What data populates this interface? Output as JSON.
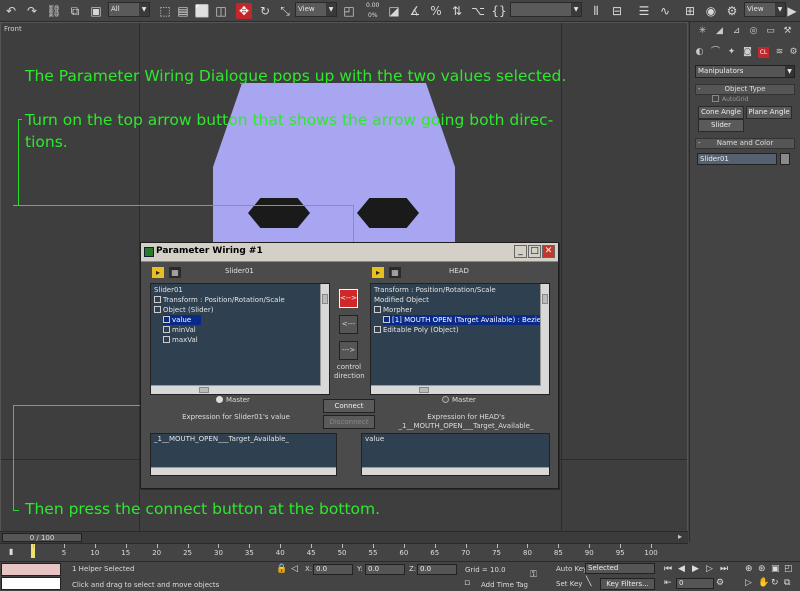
{
  "toolbar": {
    "selection_filter": "All",
    "ref_coord": "View",
    "snap_value": "0.00",
    "snap_unit": "0%",
    "named_selection": "",
    "view_dropdown": "View"
  },
  "viewport": {
    "label": "Front",
    "annotations": {
      "line1": "The Parameter Wiring Dialogue pops up with the two values selected.",
      "line2": "Turn on the top arrow button that shows the arrow going both direc-",
      "line3": "tions.",
      "line4": "Then press the connect button at the bottom."
    }
  },
  "dialog": {
    "title": "Parameter Wiring #1",
    "left_header": "Slider01",
    "right_header": "HEAD",
    "left_tree": [
      "Slider01",
      "Transform : Position/Rotation/Scale",
      "Object (Slider)",
      "value",
      "minVal",
      "maxVal"
    ],
    "right_tree": [
      "Transform : Position/Rotation/Scale",
      "Modified Object",
      "Morpher",
      "[1] MOUTH OPEN  (Target Available) : Bezier Float",
      "Editable Poly (Object)"
    ],
    "btn_both": "<-->",
    "btn_left": "<---",
    "btn_right": "--->",
    "control_direction": [
      "control",
      "direction"
    ],
    "master_left": "Master",
    "master_right": "Master",
    "connect": "Connect",
    "disconnect": "Disconnect",
    "expr_left_label": "Expression for Slider01's value",
    "expr_right_label": [
      "Expression for HEAD's",
      "_1__MOUTH_OPEN___Target_Available_"
    ],
    "expr_left_value": "_1__MOUTH_OPEN___Target_Available_",
    "expr_right_value": "value"
  },
  "command_panel": {
    "category": "Manipulators",
    "rollout_object_type": "Object Type",
    "autogrid": "AutoGrid",
    "buttons": [
      "Cone Angle",
      "Plane Angle",
      "Slider"
    ],
    "rollout_name_color": "Name and Color",
    "object_name": "Slider01"
  },
  "timeline": {
    "frame_indicator": "0 / 100",
    "ticks": [
      "5",
      "10",
      "15",
      "20",
      "25",
      "30",
      "35",
      "40",
      "45",
      "50",
      "55",
      "60",
      "65",
      "70",
      "75",
      "80",
      "85",
      "90",
      "95",
      "100"
    ]
  },
  "status": {
    "selection": "1 Helper Selected",
    "prompt": "Click and drag to select and move objects",
    "x_value": "0.0",
    "y_value": "0.0",
    "z_value": "0.0",
    "grid": "Grid = 10.0",
    "add_time_tag": "Add Time Tag",
    "auto_key": "Auto Key",
    "auto_key_mode": "Selected",
    "set_key": "Set Key",
    "key_filters": "Key Filters...",
    "current_frame": "0"
  }
}
